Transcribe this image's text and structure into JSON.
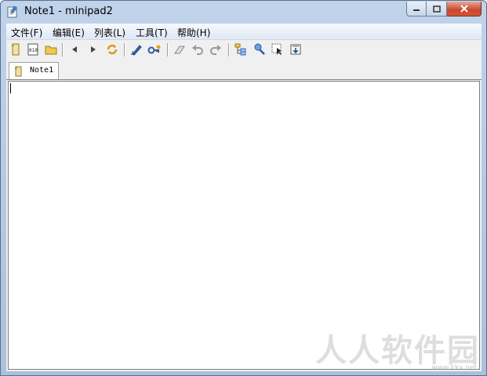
{
  "window": {
    "title": "Note1 - minipad2",
    "buttons": {
      "minimize": "minimize",
      "maximize": "maximize",
      "close": "close"
    }
  },
  "menu": [
    {
      "label": "文件(F)"
    },
    {
      "label": "编辑(E)"
    },
    {
      "label": "列表(L)"
    },
    {
      "label": "工具(T)"
    },
    {
      "label": "帮助(H)"
    }
  ],
  "toolbar": {
    "icons": [
      "new-note-icon",
      "new-binary-icon",
      "open-folder-icon",
      "back-icon",
      "forward-icon",
      "refresh-icon",
      "edit-pen-icon",
      "key-icon",
      "eraser-icon",
      "undo-icon",
      "redo-icon",
      "tree-view-icon",
      "pin-icon",
      "select-icon",
      "insert-icon"
    ]
  },
  "tabs": [
    {
      "label": "Note1",
      "icon": "note-icon",
      "active": true
    }
  ],
  "editor": {
    "content": ""
  },
  "watermark": {
    "text": "人人软件园",
    "sub": "www.kkx.net"
  },
  "colors": {
    "titlebar": "#bfd3ea",
    "close": "#c9462c",
    "accent": "#e6a11a"
  }
}
